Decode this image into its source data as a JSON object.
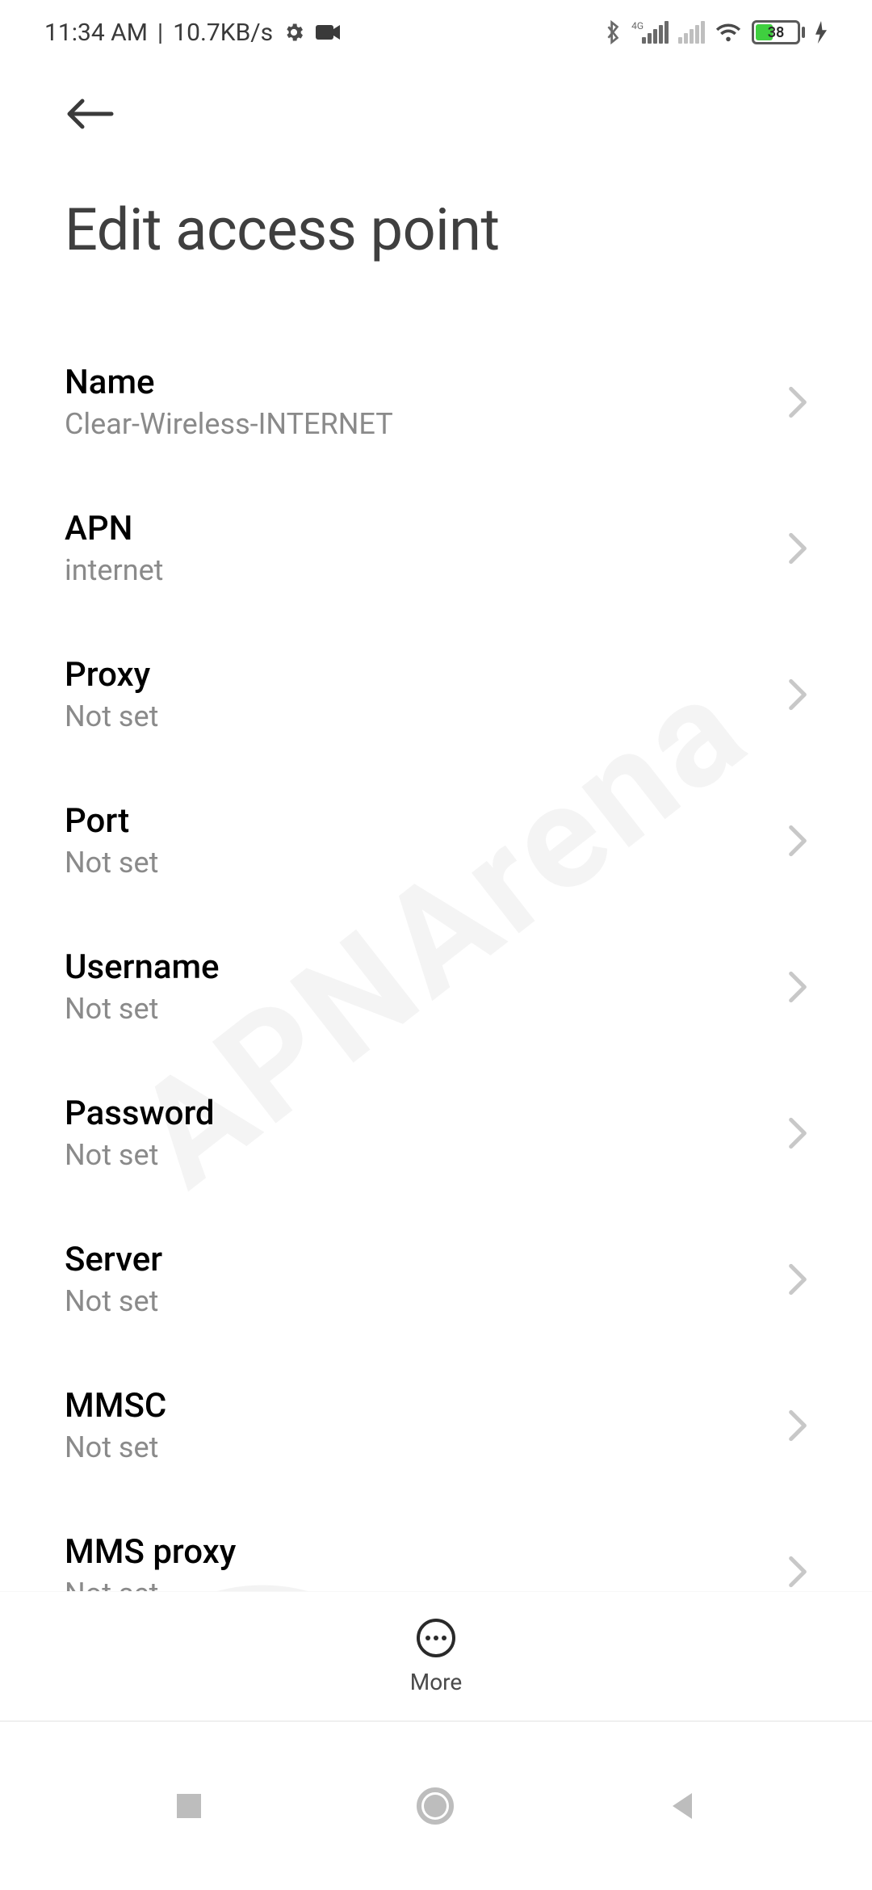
{
  "status": {
    "time": "11:34 AM",
    "separator": "|",
    "speed": "10.7KB/s",
    "network_label": "4G",
    "battery_pct": "38"
  },
  "header": {
    "title": "Edit access point"
  },
  "settings": [
    {
      "label": "Name",
      "value": "Clear-Wireless-INTERNET"
    },
    {
      "label": "APN",
      "value": "internet"
    },
    {
      "label": "Proxy",
      "value": "Not set"
    },
    {
      "label": "Port",
      "value": "Not set"
    },
    {
      "label": "Username",
      "value": "Not set"
    },
    {
      "label": "Password",
      "value": "Not set"
    },
    {
      "label": "Server",
      "value": "Not set"
    },
    {
      "label": "MMSC",
      "value": "Not set"
    },
    {
      "label": "MMS proxy",
      "value": "Not set"
    }
  ],
  "more": {
    "label": "More"
  },
  "watermark": {
    "text": "APNArena"
  }
}
